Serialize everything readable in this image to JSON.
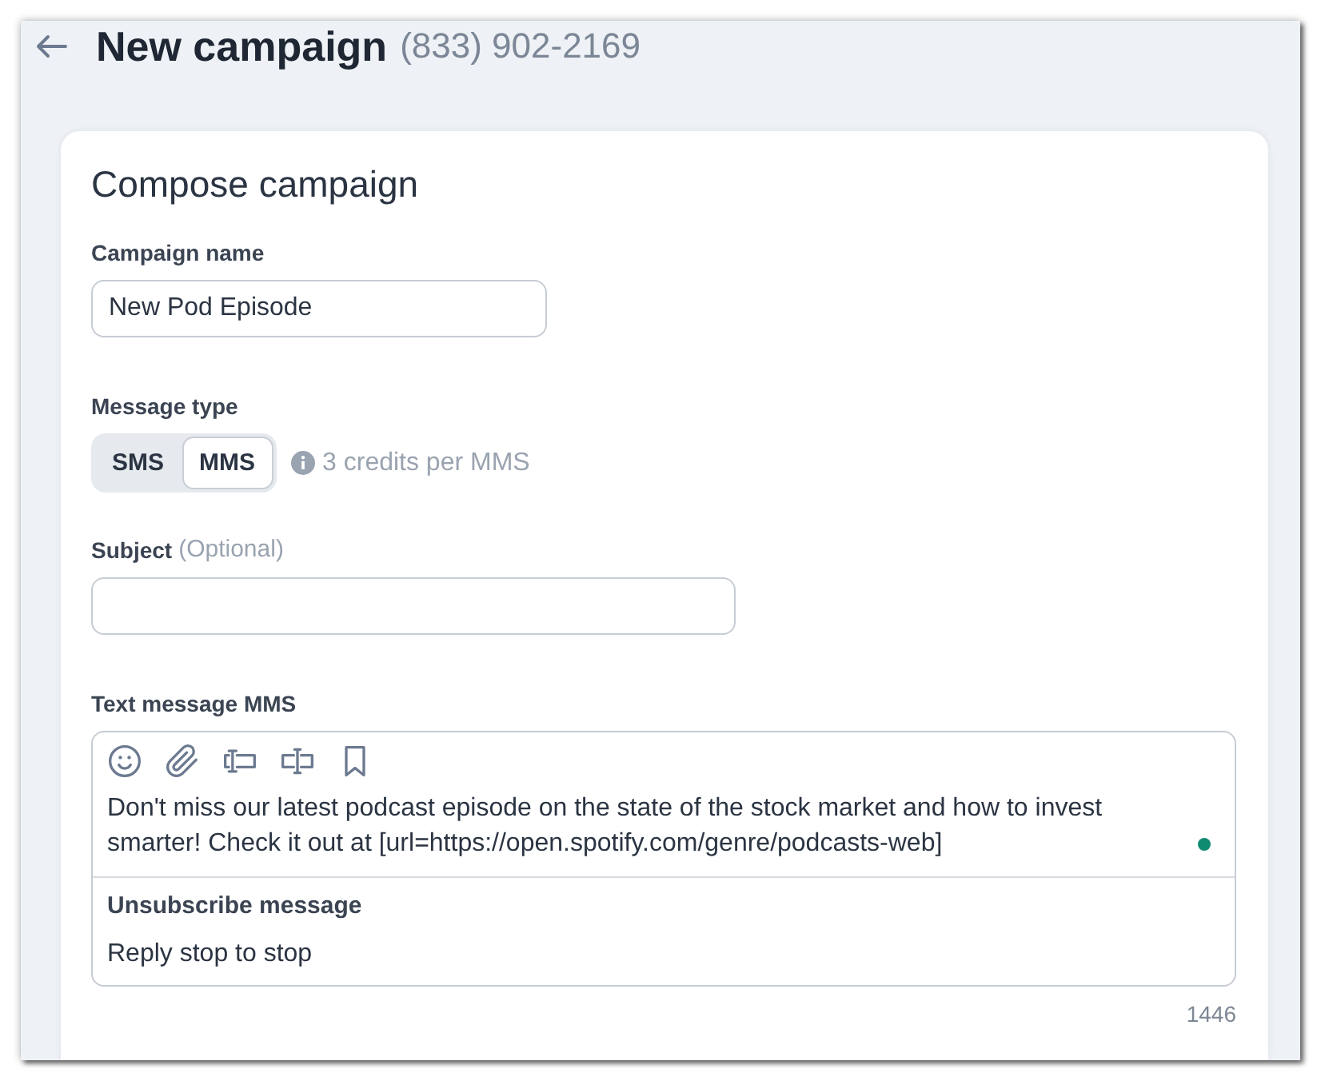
{
  "header": {
    "title": "New campaign",
    "phone": "(833) 902-2169"
  },
  "compose": {
    "title": "Compose campaign",
    "campaign_name": {
      "label": "Campaign name",
      "value": "New Pod Episode"
    },
    "message_type": {
      "label": "Message type",
      "options": [
        {
          "label": "SMS",
          "selected": false
        },
        {
          "label": "MMS",
          "selected": true
        }
      ],
      "note": "3 credits per MMS"
    },
    "subject": {
      "label": "Subject",
      "hint": "(Optional)"
    },
    "text_message": {
      "label": "Text message MMS",
      "body": "Don't miss our latest podcast episode on the state of the stock market and how to invest smarter! Check it out at [url=https://open.spotify.com/genre/podcasts-web]",
      "unsubscribe_label": "Unsubscribe message",
      "unsubscribe_text": "Reply stop to stop",
      "character_count": "1446"
    }
  }
}
